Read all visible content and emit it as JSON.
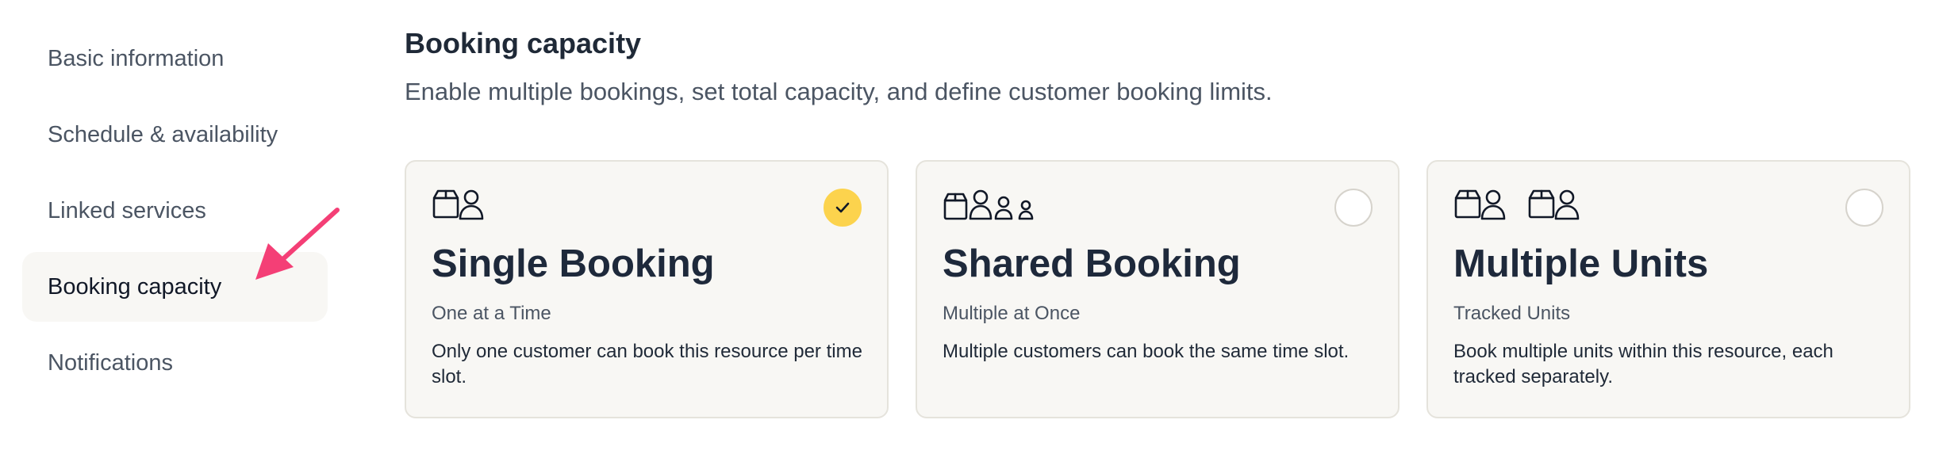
{
  "sidebar": {
    "items": [
      {
        "label": "Basic information"
      },
      {
        "label": "Schedule & availability"
      },
      {
        "label": "Linked services"
      },
      {
        "label": "Booking capacity",
        "active": true
      },
      {
        "label": "Notifications"
      }
    ]
  },
  "header": {
    "title": "Booking capacity",
    "subtitle": "Enable multiple bookings, set total capacity, and define customer booking limits."
  },
  "options": [
    {
      "icon": "box-person-icon",
      "title": "Single Booking",
      "tagline": "One at a Time",
      "description": "Only one customer can book this resource per time slot.",
      "selected": true
    },
    {
      "icon": "box-people-icon",
      "title": "Shared Booking",
      "tagline": "Multiple at Once",
      "description": "Multiple customers can book the same time slot.",
      "selected": false
    },
    {
      "icon": "box-person-pair-icon",
      "title": "Multiple Units",
      "tagline": "Tracked Units",
      "description": "Book multiple units within this resource, each tracked separately.",
      "selected": false
    }
  ],
  "colors": {
    "accent": "#fcd34d",
    "arrow": "#f43f76",
    "card_bg": "#f8f7f4"
  }
}
